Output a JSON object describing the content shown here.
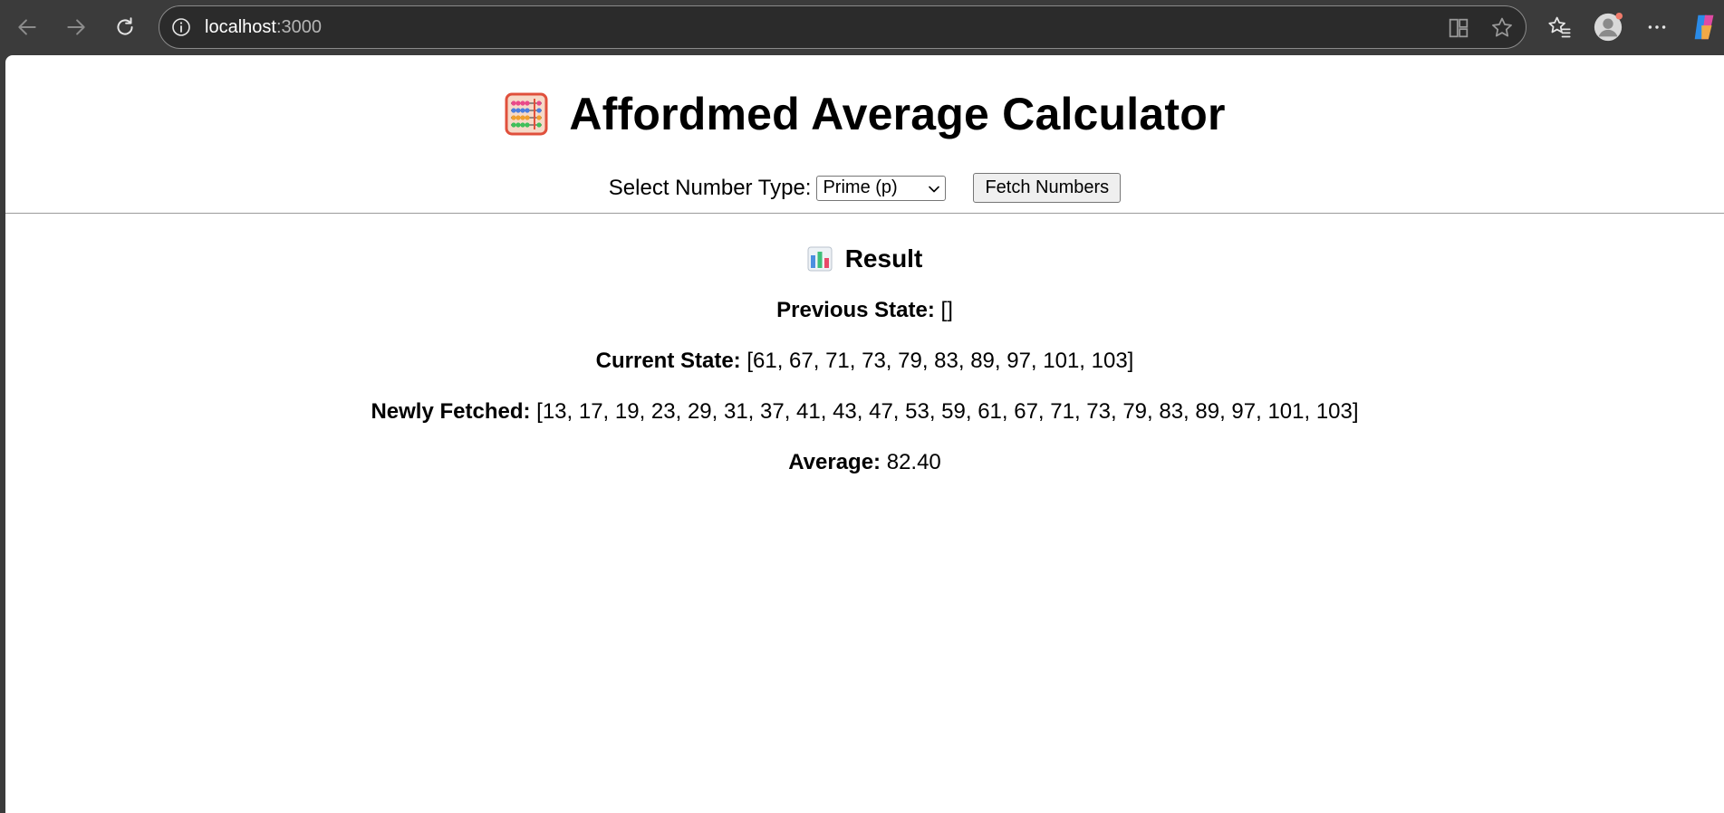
{
  "browser": {
    "url_host": "localhost",
    "url_port": ":3000",
    "icons": [
      "back-icon",
      "forward-icon",
      "refresh-icon",
      "info-icon",
      "apps-icon",
      "star-icon",
      "favorites-icon",
      "profile-icon",
      "more-icon",
      "copilot-icon"
    ]
  },
  "page": {
    "title": "Affordmed Average Calculator",
    "title_icon": "abacus-icon",
    "select_label": "Select Number Type:",
    "select_value": "Prime (p)",
    "fetch_button": "Fetch Numbers"
  },
  "result": {
    "heading": "Result",
    "heading_icon": "bar-chart-icon",
    "previous_label": "Previous State:",
    "previous_value": "[]",
    "current_label": "Current State:",
    "current_value": "[61, 67, 71, 73, 79, 83, 89, 97, 101, 103]",
    "newly_label": "Newly Fetched:",
    "newly_value": "[13, 17, 19, 23, 29, 31, 37, 41, 43, 47, 53, 59, 61, 67, 71, 73, 79, 83, 89, 97, 101, 103]",
    "average_label": "Average:",
    "average_value": "82.40"
  }
}
